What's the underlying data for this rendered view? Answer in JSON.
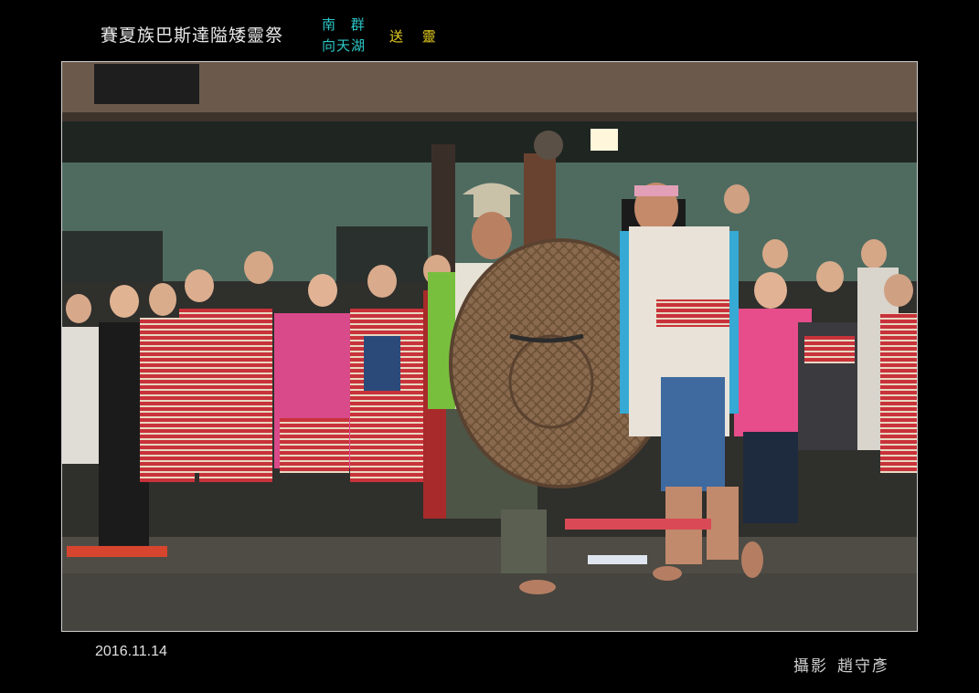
{
  "header": {
    "title": "賽夏族巴斯達隘矮靈祭",
    "group_line1": "南 群",
    "group_line2": "向天湖",
    "event": "送 靈"
  },
  "photo": {
    "subject": "festival-dancers"
  },
  "footer": {
    "date": "2016.11.14",
    "credit_label": "攝影",
    "photographer": "趙守彥"
  },
  "colors": {
    "background": "#000000",
    "title": "#e8e8e8",
    "group": "#2ec8c8",
    "event": "#e8d020"
  }
}
